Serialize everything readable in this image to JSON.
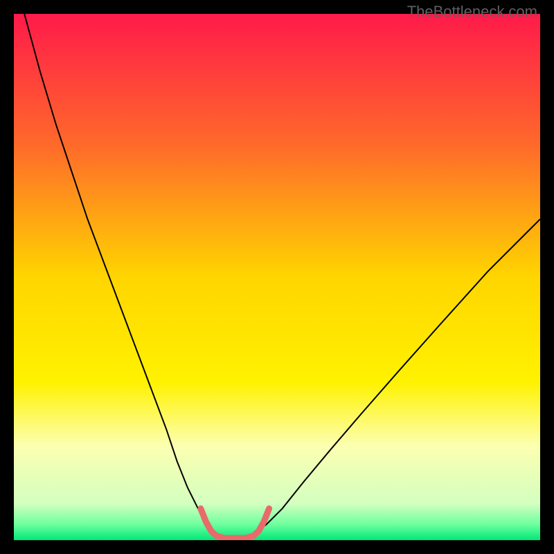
{
  "watermark": "TheBottleneck.com",
  "chart_data": {
    "type": "line",
    "title": "",
    "xlabel": "",
    "ylabel": "",
    "xlim": [
      0,
      100
    ],
    "ylim": [
      0,
      100
    ],
    "background_gradient": {
      "stops": [
        {
          "offset": 0,
          "color": "#ff1a4a"
        },
        {
          "offset": 25,
          "color": "#ff6a2a"
        },
        {
          "offset": 50,
          "color": "#ffd500"
        },
        {
          "offset": 70,
          "color": "#fff200"
        },
        {
          "offset": 82,
          "color": "#fcffb0"
        },
        {
          "offset": 93,
          "color": "#d4ffc0"
        },
        {
          "offset": 97,
          "color": "#6eff9e"
        },
        {
          "offset": 100,
          "color": "#00e878"
        }
      ]
    },
    "series": [
      {
        "name": "curve-left",
        "type": "line",
        "color": "#000000",
        "width": 2,
        "x": [
          2,
          5,
          8,
          11,
          14,
          17,
          20,
          23,
          26,
          29,
          31,
          33,
          35,
          36.5,
          37.5
        ],
        "y": [
          100,
          89,
          79,
          70,
          61,
          53,
          45,
          37,
          29,
          21,
          15,
          10,
          6,
          3,
          1.5
        ]
      },
      {
        "name": "curve-right",
        "type": "line",
        "color": "#000000",
        "width": 2,
        "x": [
          46,
          48,
          51,
          55,
          60,
          66,
          73,
          81,
          90,
          100
        ],
        "y": [
          1.5,
          3,
          6,
          11,
          17,
          24,
          32,
          41,
          51,
          61
        ]
      },
      {
        "name": "optimal-zone",
        "type": "line",
        "color": "#e86a6a",
        "width": 9,
        "linecap": "round",
        "x": [
          35.5,
          36.5,
          37.5,
          38.5,
          40,
          42,
          44,
          45.5,
          46.5,
          47.5,
          48.5
        ],
        "y": [
          6,
          3.5,
          1.7,
          0.8,
          0.4,
          0.4,
          0.4,
          0.8,
          1.7,
          3.5,
          6
        ]
      }
    ]
  }
}
